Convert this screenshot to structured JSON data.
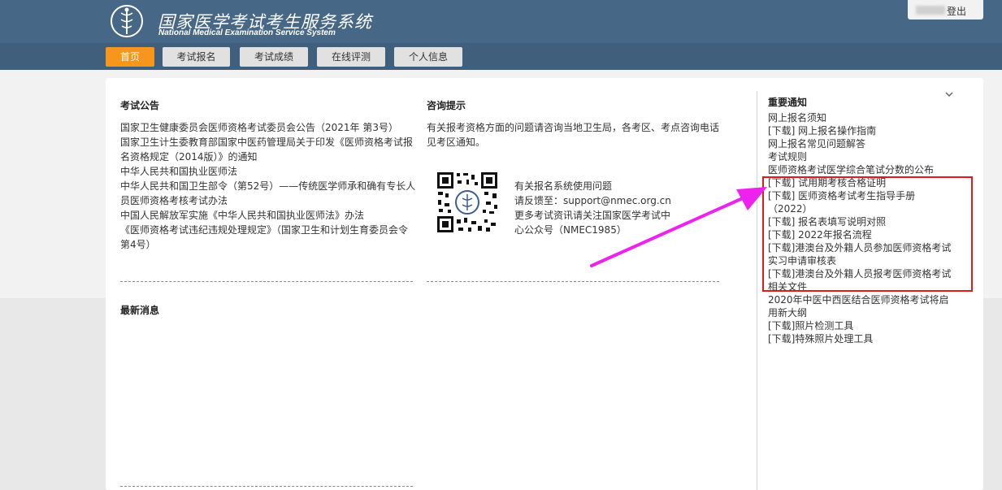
{
  "header": {
    "title": "国家医学考试考生服务系统",
    "subtitle": "National Medical Examination Service System",
    "login_label": "登出",
    "logo_icon": "medical-caduceus-icon"
  },
  "nav": {
    "items": [
      {
        "label": "首页",
        "active": true
      },
      {
        "label": "考试报名",
        "active": false
      },
      {
        "label": "考试成绩",
        "active": false
      },
      {
        "label": "在线评测",
        "active": false
      },
      {
        "label": "个人信息",
        "active": false
      }
    ]
  },
  "announcements": {
    "title": "考试公告",
    "lines": [
      "国家卫生健康委员会医师资格考试委员会公告（2021年 第3号）",
      "国家卫生计生委教育部国家中医药管理局关于印发《医师资格考试报",
      "名资格规定（2014版）》的通知",
      "中华人民共和国执业医师法",
      "中华人民共和国卫生部令（第52号）——传统医学师承和确有专长人",
      "员医师资格考核考试办法",
      "中国人民解放军实施《中华人民共和国执业医师法》办法",
      "《医师资格考试违纪违规处理规定》（国家卫生和计划生育委员会令",
      "第4号）"
    ]
  },
  "consult": {
    "title": "咨询提示",
    "text_lines": [
      "有关报考资格方面的问题请咨询当地卫生局，各考区、考点咨询电话",
      "见考区通知。"
    ],
    "help_lines": [
      "有关报名系统使用问题",
      "请反馈至：support@nmec.org.cn",
      "更多考试资讯请关注国家医学考试中",
      "心公众号（NMEC1985）"
    ]
  },
  "latest": {
    "title": "最新消息"
  },
  "notices": {
    "title": "重要通知",
    "lines": [
      "网上报名须知",
      "[下载] 网上报名操作指南",
      "网上报名常见问题解答",
      "考试规则",
      "医师资格考试医学综合笔试分数的公布",
      "[下载] 试用期考核合格证明",
      "[下载] 医师资格考试考生指导手册",
      "（2022）",
      "[下载] 报名表填写说明对照",
      "[下载] 2022年报名流程",
      "[下载]港澳台及外籍人员参加医师资格考试",
      "实习申请审核表",
      "[下载]港澳台及外籍人员报考医师资格考试",
      "相关文件",
      "2020年中医中西医结合医师资格考试将启",
      "用新大纲",
      "[下载]照片检测工具",
      "[下载]特殊照片处理工具"
    ]
  },
  "colors": {
    "header_bg": "#466786",
    "nav_bg": "#3f5f7c",
    "nav_active": "#f7961d",
    "highlight_box": "#e01b1b",
    "arrow": "#ee22ee"
  }
}
